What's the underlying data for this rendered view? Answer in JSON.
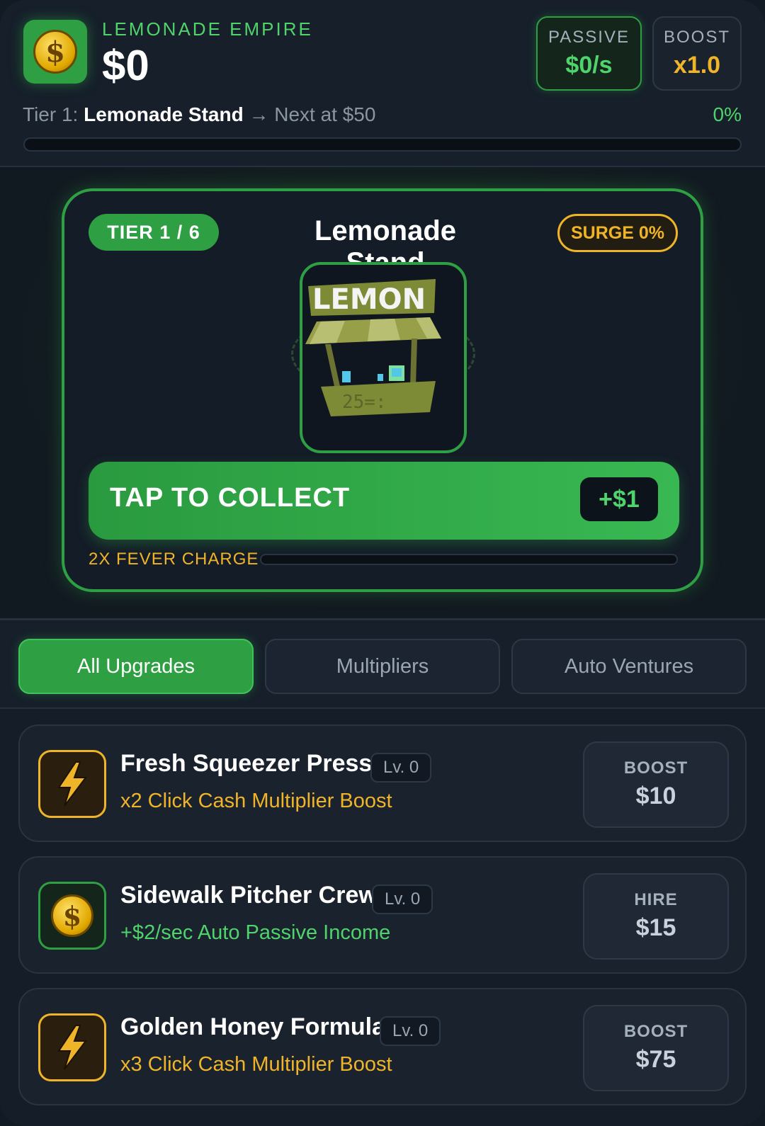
{
  "header": {
    "app_title": "LEMONADE EMPIRE",
    "cash": "$0",
    "passive": {
      "label": "PASSIVE",
      "value": "$0/s"
    },
    "boost": {
      "label": "BOOST",
      "value": "x1.0"
    },
    "tier_prefix": "Tier 1:",
    "tier_name": "Lemonade Stand",
    "tier_next": "→ Next at $50",
    "tier_progress_label": "0%",
    "tier_progress": 0
  },
  "stage": {
    "tier_badge": "TIER 1 / 6",
    "title": "Lemonade Stand",
    "surge": "SURGE 0%",
    "sign_text": "LEMON",
    "collect_label": "TAP TO COLLECT",
    "collect_amount": "+$1",
    "fever_label": "2X FEVER CHARGE",
    "fever_progress": 0
  },
  "tabs": [
    {
      "label": "All Upgrades",
      "active": true
    },
    {
      "label": "Multipliers",
      "active": false
    },
    {
      "label": "Auto Ventures",
      "active": false
    }
  ],
  "upgrades": [
    {
      "name": "Fresh Squeezer Press",
      "level": "Lv. 0",
      "desc": "x2 Click Cash Multiplier Boost",
      "action": "BOOST",
      "price": "$10",
      "icon": "lightning-icon"
    },
    {
      "name": "Sidewalk Pitcher Crew",
      "level": "Lv. 0",
      "desc": "+$2/sec Auto Passive Income",
      "action": "HIRE",
      "price": "$15",
      "icon": "dollar-coin-icon"
    },
    {
      "name": "Golden Honey Formula",
      "level": "Lv. 0",
      "desc": "x3 Click Cash Multiplier Boost",
      "action": "BOOST",
      "price": "$75",
      "icon": "lightning-icon"
    }
  ],
  "colors": {
    "accent_green": "#2ea043",
    "accent_gold": "#f0b429",
    "background": "#151d28"
  }
}
